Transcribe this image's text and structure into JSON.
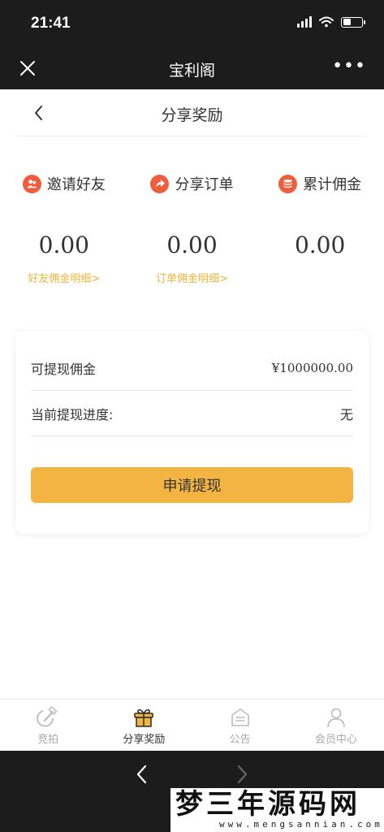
{
  "status_bar": {
    "time": "21:41",
    "battery_level": 0.45
  },
  "app_bar": {
    "title": "宝利阁",
    "close_icon": "close-icon",
    "more_icon": "more-icon",
    "more_label": "•••"
  },
  "header": {
    "title": "分享奖励",
    "back_icon": "chevron-left-icon"
  },
  "stats": [
    {
      "label": "邀请好友",
      "value": "0.00",
      "link": "好友佣金明细>",
      "icon": "users-icon"
    },
    {
      "label": "分享订单",
      "value": "0.00",
      "link": "订单佣金明细>",
      "icon": "share-arrow-icon"
    },
    {
      "label": "累计佣金",
      "value": "0.00",
      "link": "",
      "icon": "coins-icon"
    }
  ],
  "withdraw_card": {
    "available_label": "可提现佣金",
    "available_value": "¥1000000.00",
    "progress_label": "当前提现进度:",
    "progress_value": "无",
    "button_label": "申请提现"
  },
  "tabbar": [
    {
      "label": "竞拍",
      "icon": "auction-icon",
      "active": false
    },
    {
      "label": "分享奖励",
      "icon": "gift-icon",
      "active": true
    },
    {
      "label": "公告",
      "icon": "notice-icon",
      "active": false
    },
    {
      "label": "会员中心",
      "icon": "user-icon",
      "active": false
    }
  ],
  "watermark": {
    "text": "梦三年源码网",
    "sub": "www.mengsannian.com"
  },
  "colors": {
    "accent": "#f3b441",
    "link": "#f0b43a",
    "icon_red": "#ef5d3c",
    "dark_bar": "#1c1c1c"
  }
}
